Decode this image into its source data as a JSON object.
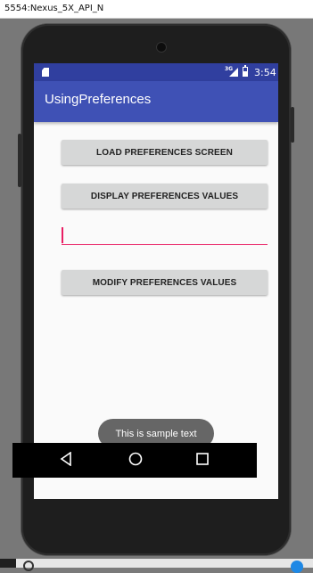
{
  "window": {
    "title": "5554:Nexus_5X_API_N"
  },
  "status_bar": {
    "time": "3:54",
    "network": "3G",
    "icons": [
      "sd-card-icon",
      "signal-icon",
      "battery-icon"
    ]
  },
  "app_bar": {
    "title": "UsingPreferences"
  },
  "buttons": {
    "load": "LOAD PREFERENCES SCREEN",
    "display": "DISPLAY PREFERENCES VALUES",
    "modify": "MODIFY PREFERENCES VALUES"
  },
  "input": {
    "value": ""
  },
  "toast": {
    "text": "This is sample text"
  },
  "nav": {
    "icons": [
      "back-icon",
      "home-icon",
      "recents-icon"
    ]
  },
  "colors": {
    "status_bar": "#303f9f",
    "app_bar": "#3f51b5",
    "accent": "#e91e63",
    "button": "#d6d7d7",
    "toast": "#666666"
  }
}
